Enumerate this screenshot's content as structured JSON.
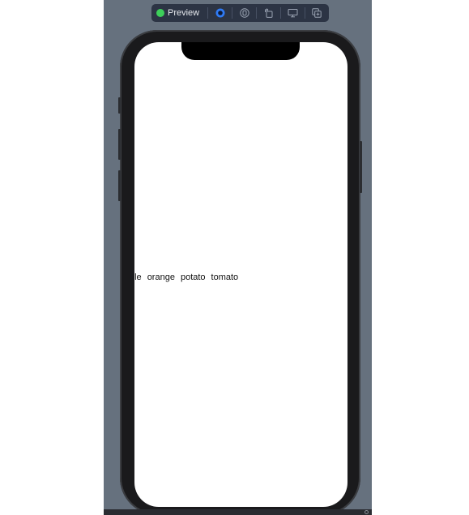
{
  "toolbar": {
    "preview_label": "Preview",
    "buttons": [
      {
        "name": "live-preview-icon"
      },
      {
        "name": "selectable-icon"
      },
      {
        "name": "rotate-device-icon"
      },
      {
        "name": "device-settings-icon"
      },
      {
        "name": "duplicate-preview-icon"
      }
    ]
  },
  "words": [
    "ple",
    "orange",
    "potato",
    "tomato"
  ],
  "colors": {
    "canvas": "#66717e",
    "toolbar": "#2c3444",
    "live_indicator": "#3dcf5a",
    "selected_accent": "#2f7bf6"
  }
}
